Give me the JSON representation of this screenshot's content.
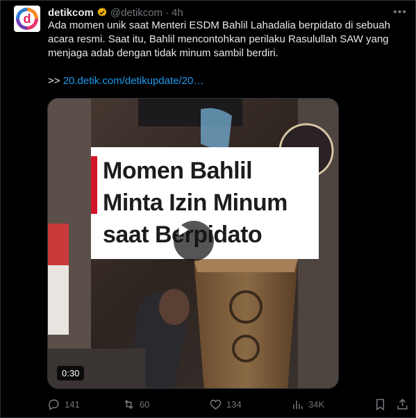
{
  "author": {
    "name": "detikcom",
    "handle": "@detikcom",
    "separator": "·",
    "time": "4h",
    "avatar_letter": "d"
  },
  "tweet": {
    "line1": "Ada momen unik saat Menteri ESDM Bahlil Lahadalia berpidato di sebuah acara resmi. Saat itu, Bahlil mencontohkan perilaku Rasulullah SAW yang menjaga adab dengan tidak minum sambil berdiri.",
    "link_prefix": ">>",
    "link_text": "20.detik.com/detikupdate/20…"
  },
  "media": {
    "overlay_lines": [
      "Momen Bahlil",
      "Minta Izin Minum",
      "saat Berpidato"
    ],
    "duration": "0:30"
  },
  "actions": {
    "replies": "141",
    "reposts": "60",
    "likes": "134",
    "views": "34K"
  },
  "icons": [
    "verified-badge-icon",
    "more-icon",
    "play-icon",
    "reply-icon",
    "repost-icon",
    "like-icon",
    "views-icon",
    "bookmark-icon",
    "share-icon"
  ],
  "colors": {
    "link": "#1d9bf0",
    "badge": "#f4b400",
    "muted": "#71767b",
    "overlay_bar": "#d4142a"
  }
}
